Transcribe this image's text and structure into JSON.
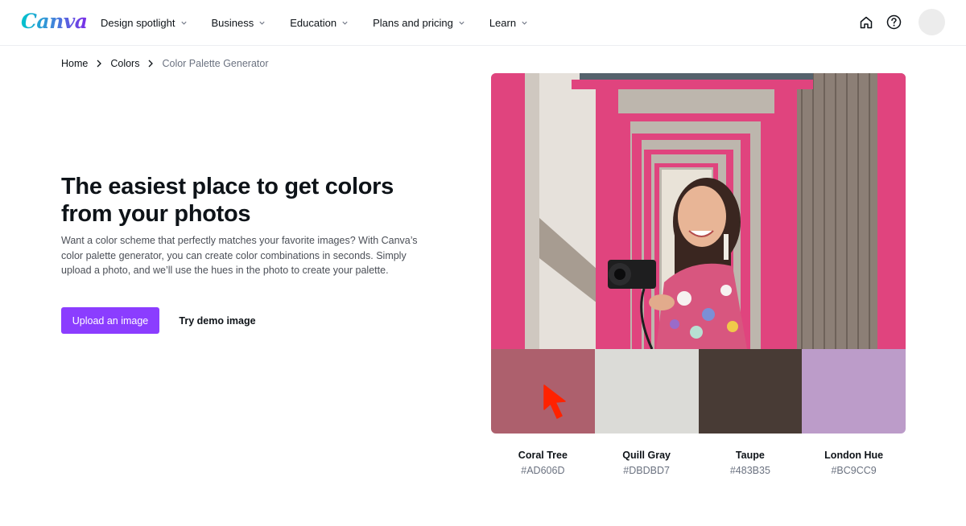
{
  "header": {
    "logo_text": "Canva",
    "nav": [
      {
        "label": "Design spotlight"
      },
      {
        "label": "Business"
      },
      {
        "label": "Education"
      },
      {
        "label": "Plans and pricing"
      },
      {
        "label": "Learn"
      }
    ]
  },
  "breadcrumb": {
    "home": "Home",
    "colors": "Colors",
    "current": "Color Palette Generator"
  },
  "hero": {
    "title_line1": "The easiest place to get colors",
    "title_line2": "from your photos",
    "description": "Want a color scheme that perfectly matches your favorite images? With Canva’s color palette generator, you can create color combinations in seconds. Simply upload a photo, and we’ll use the hues in the photo to create your palette.",
    "upload_button": "Upload an image",
    "demo_button": "Try demo image"
  },
  "palette": [
    {
      "name": "Coral Tree",
      "hex": "#AD606D",
      "color": "#ad606d"
    },
    {
      "name": "Quill Gray",
      "hex": "#DBDBD7",
      "color": "#dbdbd7"
    },
    {
      "name": "Taupe",
      "hex": "#483B35",
      "color": "#483b35"
    },
    {
      "name": "London Hue",
      "hex": "#BC9CC9",
      "color": "#bc9cc9"
    }
  ],
  "colors": {
    "brand_purple": "#8b3dff",
    "pink_frame": "#e0447e",
    "cursor_red": "#ff2200"
  },
  "icons": [
    "chevron-down-icon",
    "home-icon",
    "help-icon",
    "chevron-right-icon",
    "cursor-arrow-icon"
  ]
}
